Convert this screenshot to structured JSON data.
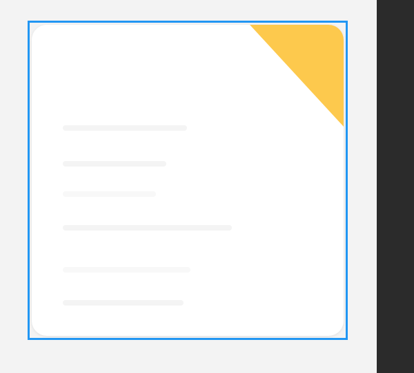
{
  "colors": {
    "selection": "#2196f3",
    "card": "#ffffff",
    "corner_accent": "#fdc94d",
    "panel": "#2b2b2b",
    "background": "#f3f3f3"
  },
  "icons": {
    "corner": "folded-corner-accent"
  }
}
